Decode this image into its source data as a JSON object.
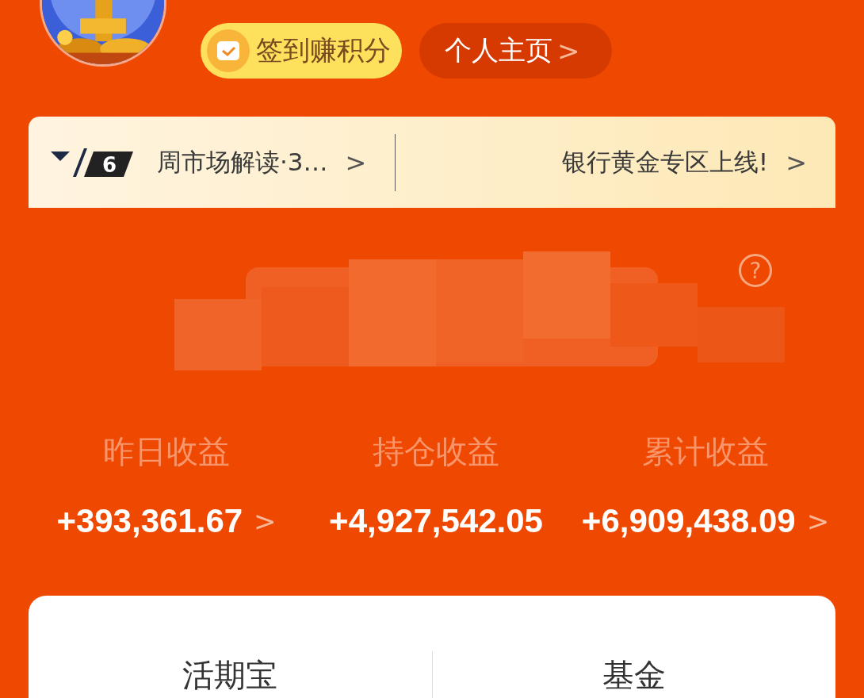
{
  "header": {
    "checkin_button": {
      "label": "签到赚积分"
    },
    "profile_button": {
      "label": "个人主页",
      "chevron": ">"
    }
  },
  "notice_bar": {
    "level_badge": "6",
    "items": [
      {
        "text": "周市场解读·3…",
        "chevron": ">"
      },
      {
        "text": "银行黄金专区上线!",
        "chevron": ">"
      }
    ]
  },
  "assets": {
    "help": "?"
  },
  "stats": [
    {
      "label": "昨日收益",
      "value": "+393,361.67",
      "chevron": ">"
    },
    {
      "label": "持仓收益",
      "value": "+4,927,542.05"
    },
    {
      "label": "累计收益",
      "value": "+6,909,438.09",
      "chevron": ">"
    }
  ],
  "tabs": [
    {
      "label": "活期宝"
    },
    {
      "label": "基金"
    }
  ]
}
